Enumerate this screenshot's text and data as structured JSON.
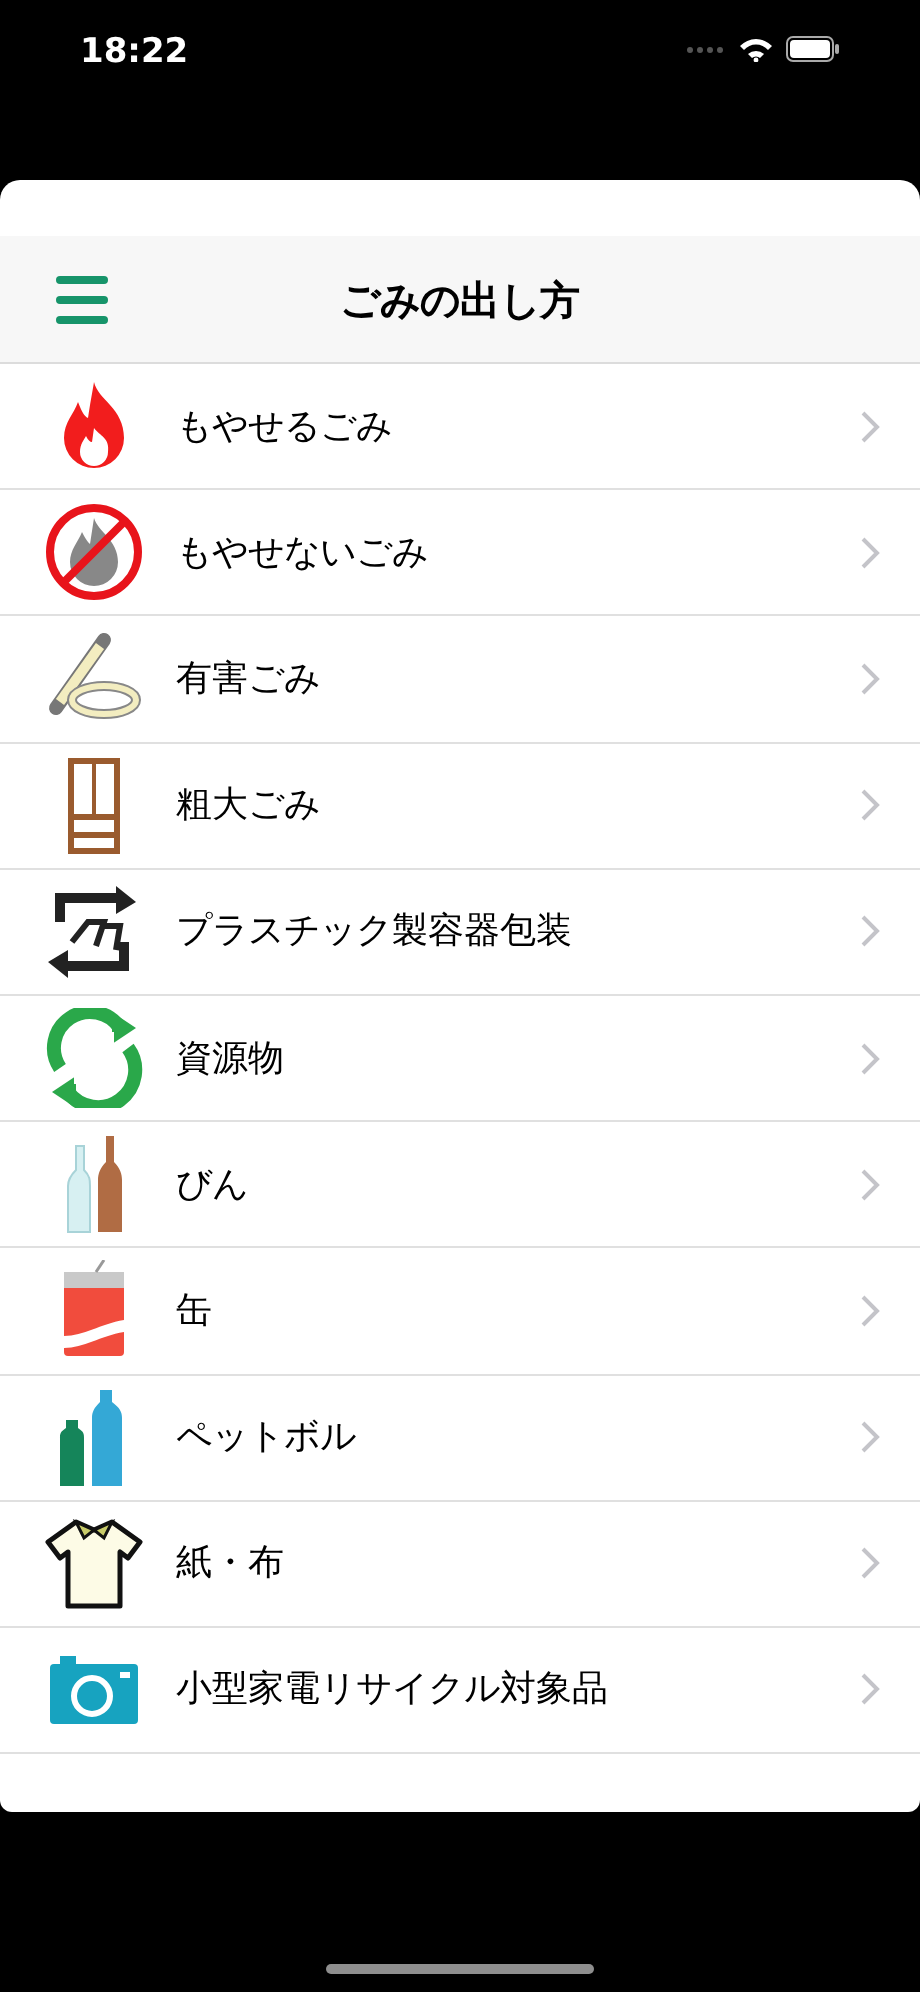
{
  "status_bar": {
    "time": "18:22"
  },
  "nav_bar": {
    "title": "ごみの出し方"
  },
  "items": [
    {
      "kind": "flame",
      "label": "もやせるごみ"
    },
    {
      "kind": "no-flame",
      "label": "もやせないごみ"
    },
    {
      "kind": "lamp",
      "label": "有害ごみ"
    },
    {
      "kind": "cabinet",
      "label": "粗大ごみ"
    },
    {
      "kind": "plastic",
      "label": "プラスチック製容器包装"
    },
    {
      "kind": "resource",
      "label": "資源物"
    },
    {
      "kind": "bottles",
      "label": "びん"
    },
    {
      "kind": "can",
      "label": "缶"
    },
    {
      "kind": "pet",
      "label": "ペットボル"
    },
    {
      "kind": "shirt",
      "label": "紙・布"
    },
    {
      "kind": "camera",
      "label": "小型家電リサイクル対象品"
    }
  ]
}
